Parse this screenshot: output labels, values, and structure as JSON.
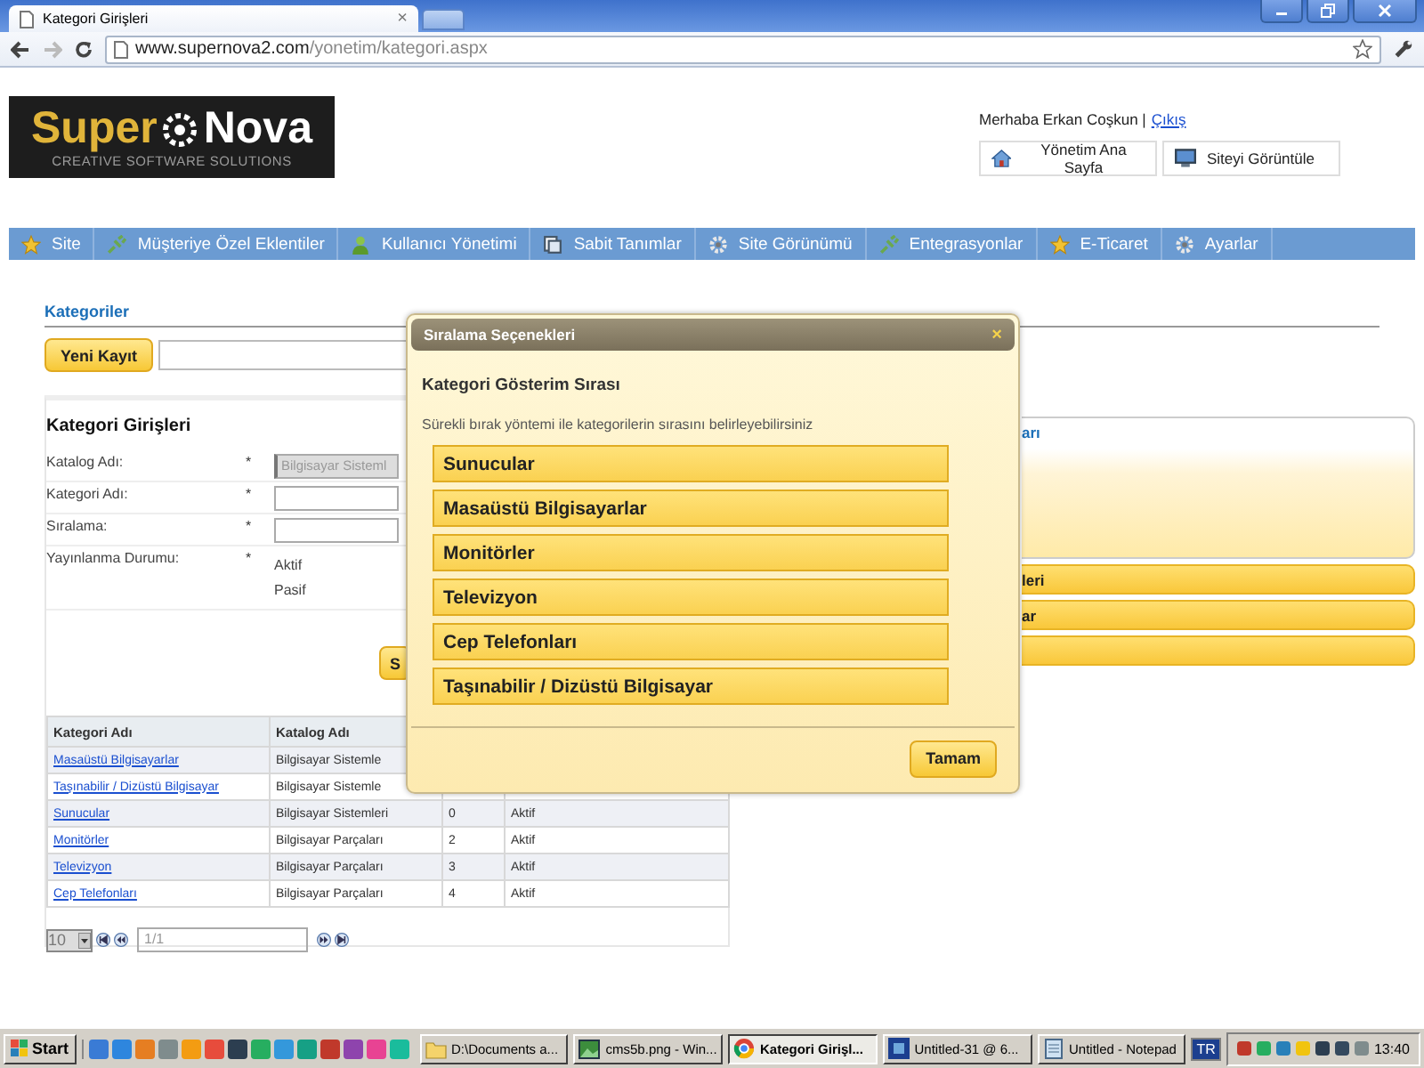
{
  "browser": {
    "tab_title": "Kategori Girişleri",
    "tab_close": "×",
    "url_host": "www.supernova2.com",
    "url_path": "/yonetim/kategori.aspx"
  },
  "logo": {
    "word_1": "Super",
    "word_2": "Nova",
    "tagline": "CREATIVE SOFTWARE SOLUTIONS"
  },
  "user": {
    "greeting": "Merhaba Erkan Coşkun |",
    "logout": "Çıkış"
  },
  "header_buttons": [
    "Yönetim Ana Sayfa",
    "Siteyi Görüntüle"
  ],
  "nav": [
    "Site",
    "Müşteriye Özel Eklentiler",
    "Kullanıcı Yönetimi",
    "Sabit Tanımlar",
    "Site Görünümü",
    "Entegrasyonlar",
    "E-Ticaret",
    "Ayarlar"
  ],
  "section_title": "Kategoriler",
  "new_button": "Yeni Kayıt",
  "form": {
    "title": "Kategori Girişleri",
    "fields": [
      {
        "label": "Katalog Adı:",
        "required": "*",
        "kind": "select",
        "value": "Bilgisayar Sisteml",
        "disabled": true
      },
      {
        "label": "Kategori Adı:",
        "required": "*",
        "kind": "text",
        "disabled": false
      },
      {
        "label": "Sıralama:",
        "required": "*",
        "kind": "text",
        "disabled": false
      },
      {
        "label": "Yayınlanma Durumu:",
        "required": "*",
        "kind": "options",
        "options": [
          "Aktif",
          "Pasif"
        ]
      }
    ],
    "save_button": "S"
  },
  "table": {
    "columns": [
      "Kategori Adı",
      "Katalog Adı"
    ],
    "rows": [
      {
        "cells": [
          "Masaüstü Bilgisayarlar",
          "Bilgisayar Sistemle"
        ]
      },
      {
        "cells": [
          "Taşınabilir / Dizüstü Bilgisayar",
          "Bilgisayar Sistemle"
        ]
      },
      {
        "cells": [
          "Sunucular",
          "Bilgisayar Sistemleri",
          "0",
          "Aktif"
        ]
      },
      {
        "cells": [
          "Monitörler",
          "Bilgisayar Parçaları",
          "2",
          "Aktif"
        ]
      },
      {
        "cells": [
          "Televizyon",
          "Bilgisayar Parçaları",
          "3",
          "Aktif"
        ]
      },
      {
        "cells": [
          "Cep Telefonları",
          "Bilgisayar Parçaları",
          "4",
          "Aktif"
        ]
      }
    ]
  },
  "pager": {
    "page_size": "10",
    "page": "1/1"
  },
  "right_panel": {
    "header": "arı",
    "bars": [
      "leri",
      "ar"
    ]
  },
  "modal": {
    "title": "Sıralama Seçenekleri",
    "close": "×",
    "heading": "Kategori Gösterim Sırası",
    "description": "Sürekli bırak yöntemi ile kategorilerin sırasını belirleyebilirsiniz",
    "items": [
      "Sunucular",
      "Masaüstü Bilgisayarlar",
      "Monitörler",
      "Televizyon",
      "Cep Telefonları",
      "Taşınabilir / Dizüstü Bilgisayar"
    ],
    "ok_button": "Tamam"
  },
  "taskbar": {
    "start": "Start",
    "tasks": [
      {
        "label": "D:\\Documents a...",
        "selected": false
      },
      {
        "label": "cms5b.png - Win...",
        "selected": false
      },
      {
        "label": "Kategori Girişl...",
        "selected": true
      },
      {
        "label": "Untitled-31 @ 6...",
        "selected": false
      },
      {
        "label": "Untitled - Notepad",
        "selected": false
      }
    ],
    "language": "TR",
    "clock": "13:40"
  }
}
